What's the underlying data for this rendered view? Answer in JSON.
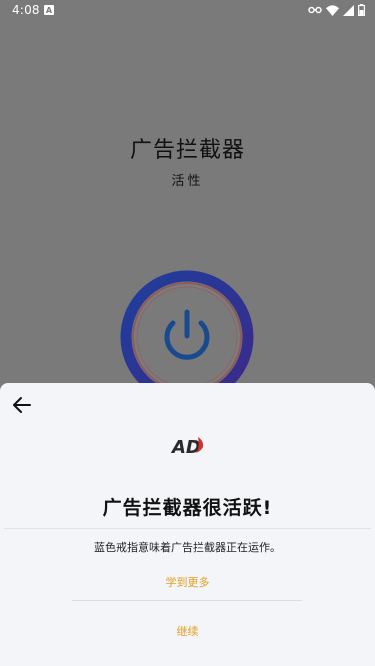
{
  "status_bar": {
    "time": "4:08",
    "notification_letter": "A"
  },
  "background": {
    "title": "广告拦截器",
    "status": "活性"
  },
  "sheet": {
    "heading": "广告拦截器很活跃!",
    "description": "蓝色戒指意味着广告拦截器正在运作。",
    "learn_more": "学到更多",
    "continue": "继续",
    "logo_text": "AD"
  },
  "colors": {
    "accent": "#e0a020",
    "ring_outer": "#2c3a9c",
    "power_icon": "#1e4b8f",
    "logo_red": "#d23232"
  }
}
